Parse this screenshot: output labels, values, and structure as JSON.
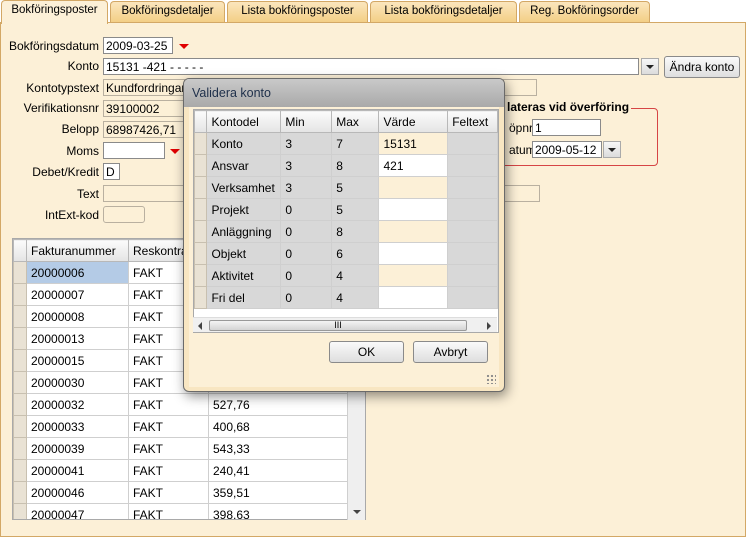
{
  "tabs": [
    {
      "label": "Bokföringsposter",
      "active": true
    },
    {
      "label": "Bokföringsdetaljer",
      "active": false
    },
    {
      "label": "Lista bokföringsposter",
      "active": false
    },
    {
      "label": "Lista bokföringsdetaljer",
      "active": false
    },
    {
      "label": "Reg. Bokföringsorder",
      "active": false
    }
  ],
  "form": {
    "bokforingsdatum_label": "Bokföringsdatum",
    "bokforingsdatum_value": "2009-03-25",
    "konto_label": "Konto",
    "konto_value": "15131 -421    -    -    -    -    -",
    "andra_konto_button": "Ändra konto",
    "kontotypstext_label": "Kontotypstext",
    "kontotypstext_value": "Kundfordringar",
    "verifikationsnr_label": "Verifikationsnr",
    "verifikationsnr_value": "39100002",
    "belopp_label": "Belopp",
    "belopp_value": "68987426,71",
    "moms_label": "Moms",
    "moms_value": "",
    "debet_kredit_label": "Debet/Kredit",
    "debet_kredit_value": "D",
    "text_label": "Text",
    "text_value": "",
    "intext_kod_label": "IntExt-kod",
    "intext_kod_value": ""
  },
  "group": {
    "title": "lateras vid överföring",
    "lopnr_label": "öpnr",
    "lopnr_value": "1",
    "datum_label": "atum",
    "datum_value": "2009-05-12"
  },
  "grid": {
    "columns": [
      "Fakturanummer",
      "Reskontra"
    ],
    "rows": [
      {
        "faktura": "20000006",
        "reskontra": "FAKT",
        "belopp": ""
      },
      {
        "faktura": "20000007",
        "reskontra": "FAKT",
        "belopp": ""
      },
      {
        "faktura": "20000008",
        "reskontra": "FAKT",
        "belopp": ""
      },
      {
        "faktura": "20000013",
        "reskontra": "FAKT",
        "belopp": ""
      },
      {
        "faktura": "20000015",
        "reskontra": "FAKT",
        "belopp": ""
      },
      {
        "faktura": "20000030",
        "reskontra": "FAKT",
        "belopp": ""
      },
      {
        "faktura": "20000032",
        "reskontra": "FAKT",
        "belopp": "527,76"
      },
      {
        "faktura": "20000033",
        "reskontra": "FAKT",
        "belopp": "400,68"
      },
      {
        "faktura": "20000039",
        "reskontra": "FAKT",
        "belopp": "543,33"
      },
      {
        "faktura": "20000041",
        "reskontra": "FAKT",
        "belopp": "240,41"
      },
      {
        "faktura": "20000046",
        "reskontra": "FAKT",
        "belopp": "359,51"
      },
      {
        "faktura": "20000047",
        "reskontra": "FAKT",
        "belopp": "398,63"
      }
    ]
  },
  "dialog": {
    "title": "Validera konto",
    "columns": [
      "Kontodel",
      "Min",
      "Max",
      "Värde",
      "Feltext"
    ],
    "rows": [
      {
        "kontodel": "Konto",
        "min": "3",
        "max": "7",
        "varde": "15131",
        "feltext": ""
      },
      {
        "kontodel": "Ansvar",
        "min": "3",
        "max": "8",
        "varde": "421",
        "feltext": ""
      },
      {
        "kontodel": "Verksamhet",
        "min": "3",
        "max": "5",
        "varde": "",
        "feltext": ""
      },
      {
        "kontodel": "Projekt",
        "min": "0",
        "max": "5",
        "varde": "",
        "feltext": ""
      },
      {
        "kontodel": "Anläggning",
        "min": "0",
        "max": "8",
        "varde": "",
        "feltext": ""
      },
      {
        "kontodel": "Objekt",
        "min": "0",
        "max": "6",
        "varde": "",
        "feltext": ""
      },
      {
        "kontodel": "Aktivitet",
        "min": "0",
        "max": "4",
        "varde": "",
        "feltext": ""
      },
      {
        "kontodel": "Fri del",
        "min": "0",
        "max": "4",
        "varde": "",
        "feltext": ""
      }
    ],
    "scroll_thumb_glyph": "III",
    "ok_button": "OK",
    "cancel_button": "Avbryt"
  },
  "colors": {
    "panel_bg": "#fcf0d7",
    "tab_bg": "#f3cf86",
    "selected_row": "#b4cbe6",
    "required_marker": "#e00000",
    "group_border": "#d64545"
  }
}
